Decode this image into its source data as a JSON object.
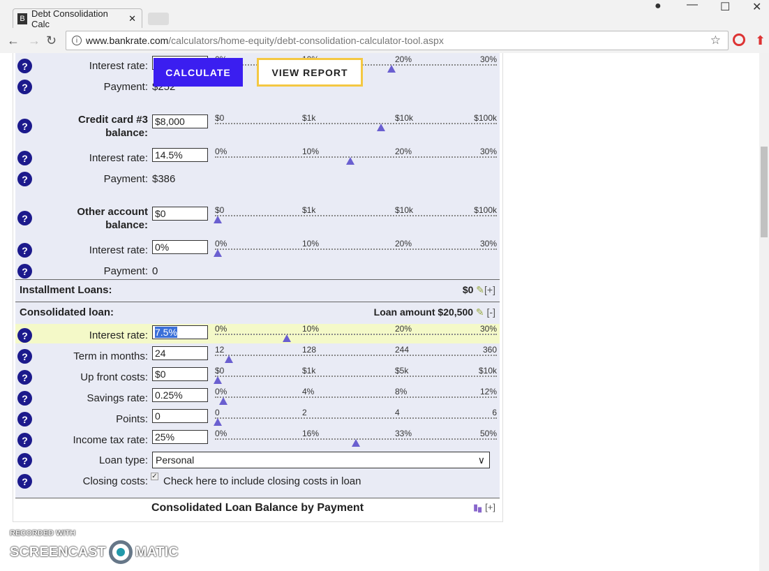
{
  "browser": {
    "tab_title": "Debt Consolidation Calc",
    "favicon": "B",
    "url_host": "www.bankrate.com",
    "url_path": "/calculators/home-equity/debt-consolidation-calculator-tool.aspx"
  },
  "buttons": {
    "calculate": "CALCULATE",
    "view_report": "VIEW REPORT"
  },
  "rows": [
    {
      "label": "Interest rate:",
      "value": "",
      "ticks": [
        "0%",
        "10%",
        "20%",
        "30%"
      ],
      "level": 0.63
    },
    {
      "label": "Payment:",
      "text": "$252"
    },
    {
      "label": "Credit card #3 balance:",
      "bold": true,
      "value": "$8,000",
      "ticks": [
        "$0",
        "$1k",
        "$10k",
        "$100k"
      ],
      "level": 0.59
    },
    {
      "label": "Interest rate:",
      "value": "14.5%",
      "ticks": [
        "0%",
        "10%",
        "20%",
        "30%"
      ],
      "level": 0.48
    },
    {
      "label": "Payment:",
      "text": "$386"
    },
    {
      "label": "Other account balance:",
      "bold": true,
      "value": "$0",
      "ticks": [
        "$0",
        "$1k",
        "$10k",
        "$100k"
      ],
      "level": 0
    },
    {
      "label": "Interest rate:",
      "value": "0%",
      "ticks": [
        "0%",
        "10%",
        "20%",
        "30%"
      ],
      "level": 0
    },
    {
      "label": "Payment:",
      "text": "0"
    }
  ],
  "installment": {
    "label": "Installment Loans:",
    "amount": "$0",
    "toggle": "[+]"
  },
  "consolidated": {
    "label": "Consolidated loan:",
    "amount": "Loan amount $20,500",
    "toggle": "[-]"
  },
  "loan_rows": [
    {
      "label": "Interest rate:",
      "value": "7.5%",
      "ticks": [
        "0%",
        "10%",
        "20%",
        "30%"
      ],
      "level": 0.25
    },
    {
      "label": "Term in months:",
      "value": "24",
      "ticks": [
        "12",
        "128",
        "244",
        "360"
      ],
      "level": 0.04
    },
    {
      "label": "Up front costs:",
      "value": "$0",
      "ticks": [
        "$0",
        "$1k",
        "$5k",
        "$10k"
      ],
      "level": 0
    },
    {
      "label": "Savings rate:",
      "value": "0.25%",
      "ticks": [
        "0%",
        "4%",
        "8%",
        "12%"
      ],
      "level": 0.02
    },
    {
      "label": "Points:",
      "value": "0",
      "ticks": [
        "0",
        "2",
        "4",
        "6"
      ],
      "level": 0
    },
    {
      "label": "Income tax rate:",
      "value": "25%",
      "ticks": [
        "0%",
        "16%",
        "33%",
        "50%"
      ],
      "level": 0.5
    }
  ],
  "loan_type": {
    "label": "Loan type:",
    "value": "Personal"
  },
  "closing": {
    "label": "Closing costs:",
    "checked": true,
    "text": "Check here to include closing costs in loan"
  },
  "chart_section": {
    "title": "Consolidated Loan Balance by Payment",
    "toggle": "[+]"
  },
  "watermark": {
    "line1": "RECORDED WITH",
    "line2a": "SCREENCAST",
    "line2b": "MATIC"
  },
  "colors": {
    "accent": "#3b1ef0",
    "help": "#1c1a8c",
    "thumb": "#6a5fd0",
    "report_border": "#f4c842"
  }
}
